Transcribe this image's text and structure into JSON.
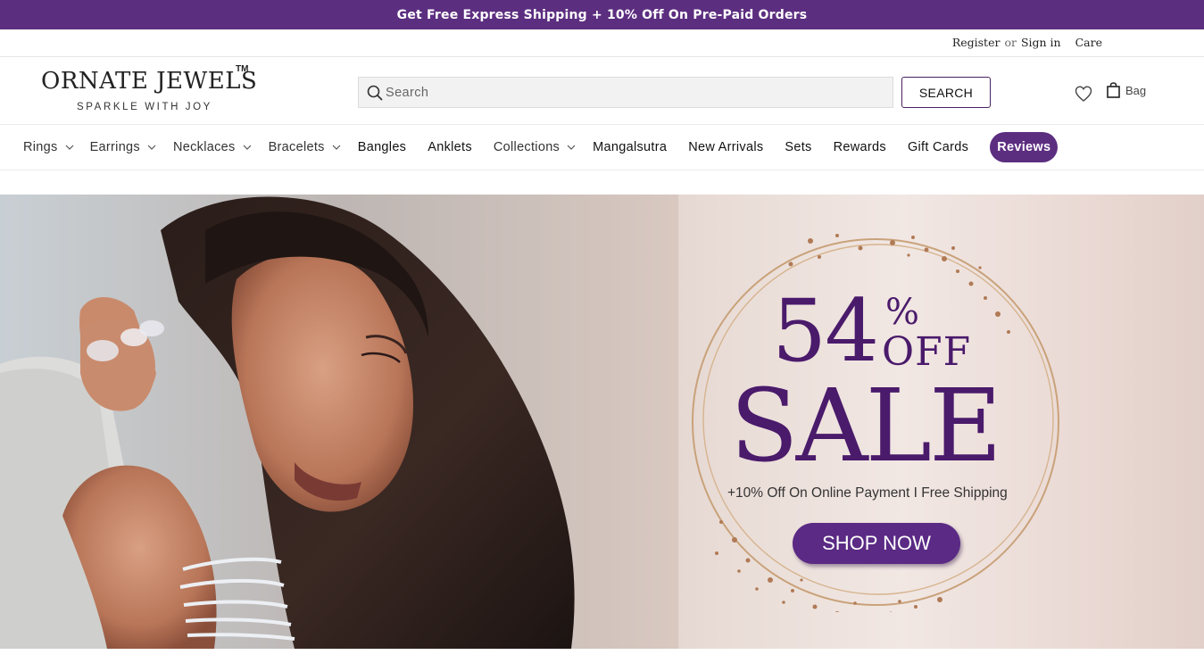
{
  "announcement": "Get Free Express Shipping + 10% Off On Pre-Paid Orders",
  "utility": {
    "register": "Register",
    "or": "or",
    "sign_in": "Sign in",
    "care": "Care"
  },
  "header": {
    "logo_text": "ORNATE JEWELS",
    "logo_tm": "TM",
    "logo_tagline": "SPARKLE WITH JOY",
    "search_placeholder": "Search",
    "search_button": "SEARCH",
    "wishlist_icon": "heart-icon",
    "bag_icon": "shopping-bag-icon",
    "bag_label": "Bag"
  },
  "nav": {
    "items": [
      {
        "label": "Rings",
        "dropdown": true
      },
      {
        "label": "Earrings",
        "dropdown": true
      },
      {
        "label": "Necklaces",
        "dropdown": true
      },
      {
        "label": "Bracelets",
        "dropdown": true
      },
      {
        "label": "Bangles",
        "dropdown": false
      },
      {
        "label": "Anklets",
        "dropdown": false
      },
      {
        "label": "Collections",
        "dropdown": true
      },
      {
        "label": "Mangalsutra",
        "dropdown": false
      },
      {
        "label": "New Arrivals",
        "dropdown": false
      },
      {
        "label": "Sets",
        "dropdown": false
      },
      {
        "label": "Rewards",
        "dropdown": false
      },
      {
        "label": "Gift Cards",
        "dropdown": false
      },
      {
        "label": "Reviews",
        "dropdown": false,
        "highlighted": true
      }
    ]
  },
  "hero": {
    "percent": "54",
    "percent_symbol": "%",
    "off": "OFF",
    "sale": "SALE",
    "subtitle": "+10% Off On Online Payment I Free Shipping",
    "cta": "SHOP NOW"
  },
  "colors": {
    "brand_purple": "#5c2e80",
    "sale_text": "#4a1a6b",
    "gold_ring": "#c9a27a"
  }
}
